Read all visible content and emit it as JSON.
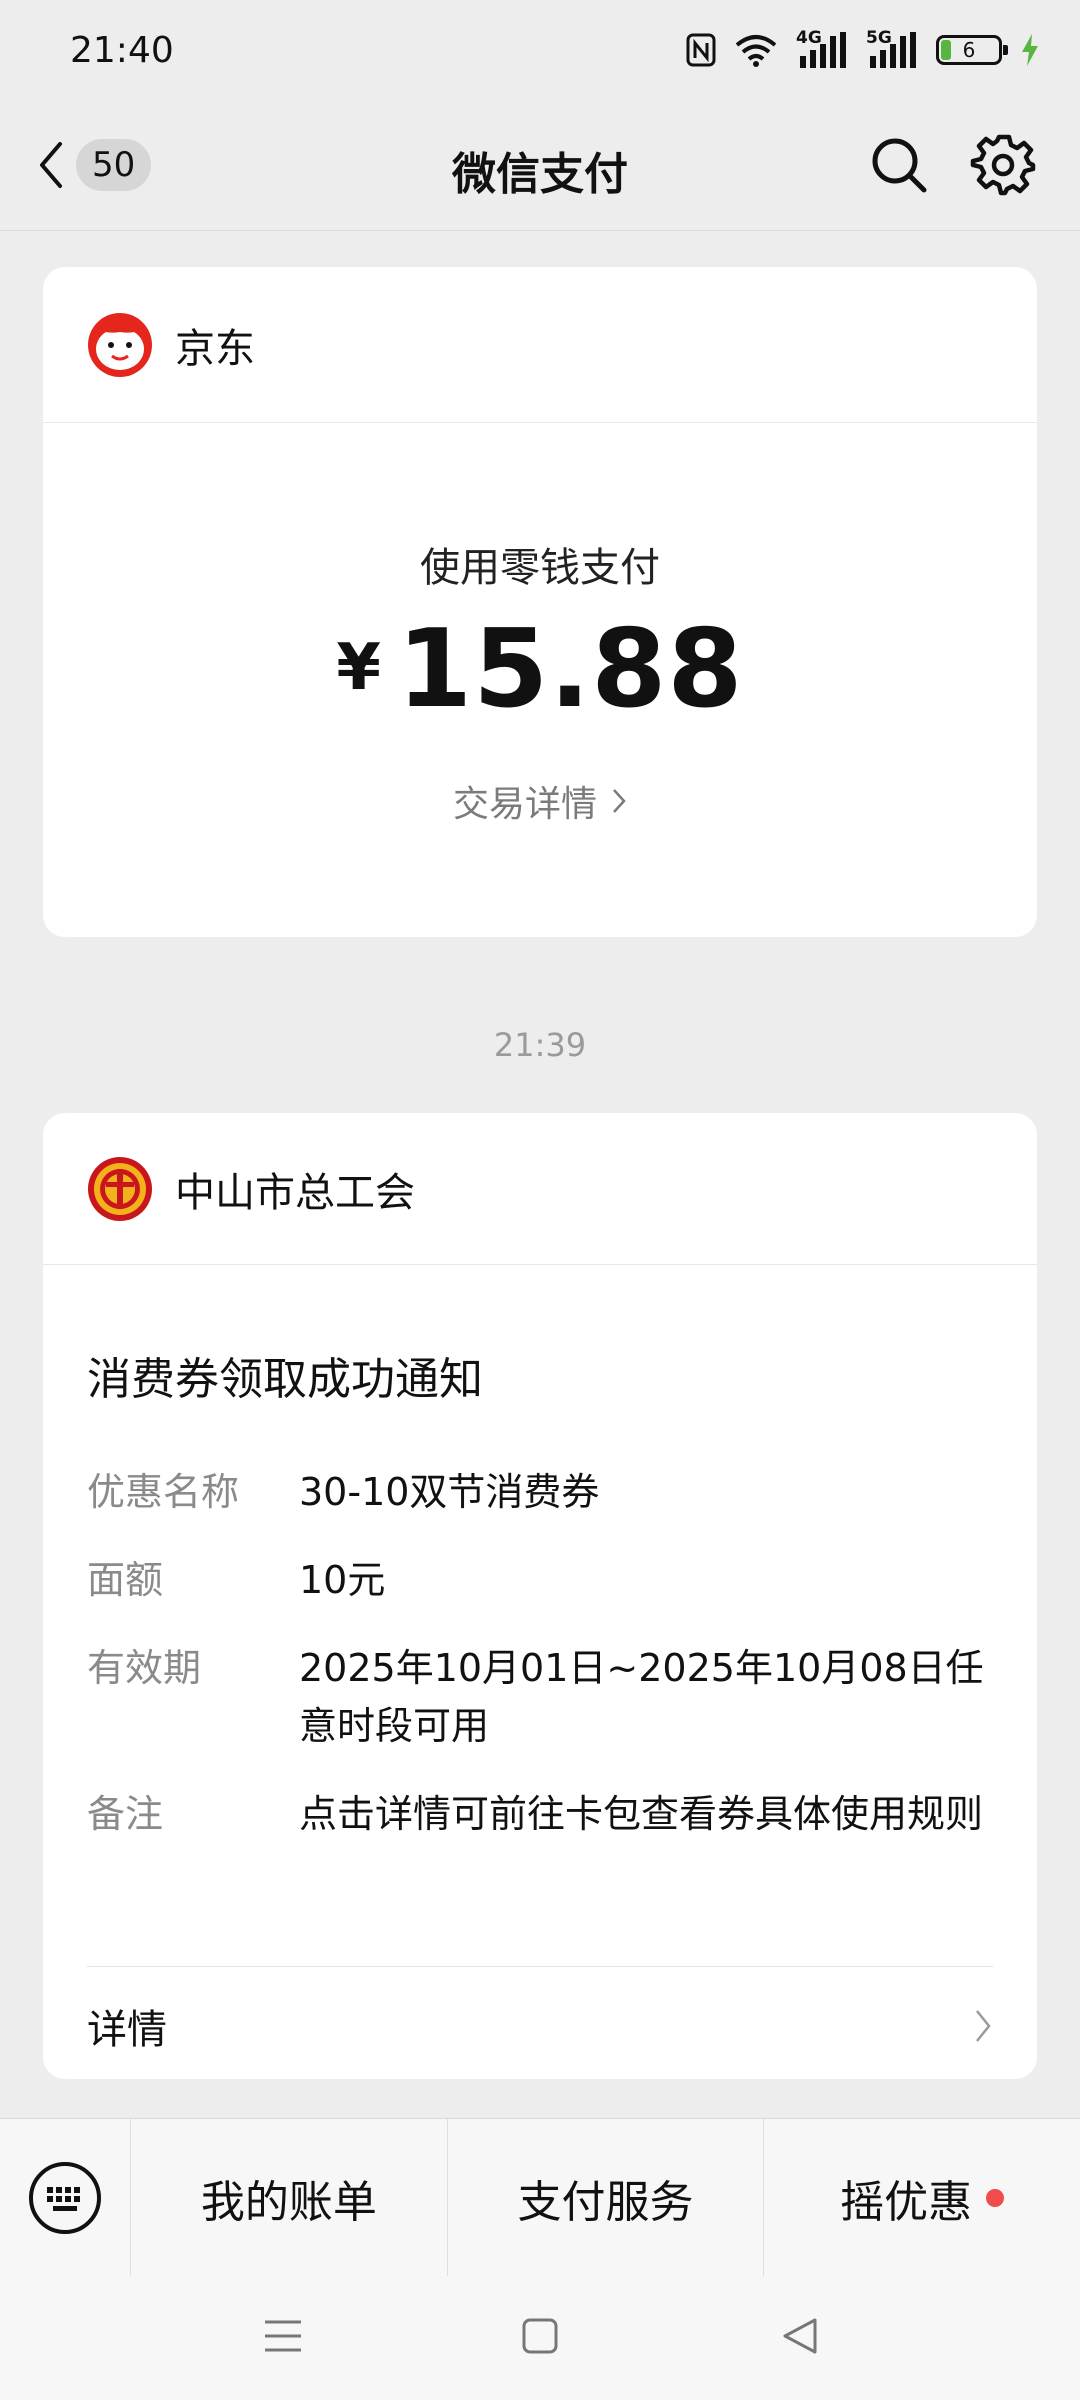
{
  "status_bar": {
    "time": "21:40",
    "network1": "4G",
    "network2": "5G",
    "battery": "6",
    "icons": [
      "nfc-icon",
      "wifi-icon",
      "signal-icon",
      "battery-icon",
      "charging-icon"
    ]
  },
  "nav": {
    "unread_count": "50",
    "title": "微信支付",
    "icons": [
      "back-arrow-icon",
      "search-icon",
      "gear-icon"
    ]
  },
  "payment_card": {
    "merchant": "京东",
    "pay_method": "使用零钱支付",
    "currency": "¥",
    "amount": "15.88",
    "detail_link": "交易详情"
  },
  "message_time": "21:39",
  "notice_card": {
    "merchant": "中山市总工会",
    "title": "消费券领取成功通知",
    "rows": [
      {
        "label": "优惠名称",
        "value": "30-10双节消费券"
      },
      {
        "label": "面额",
        "value": "10元"
      },
      {
        "label": "有效期",
        "value": "2025年10月01日~2025年10月08日任意时段可用"
      },
      {
        "label": "备注",
        "value": "点击详情可前往卡包查看券具体使用规则"
      }
    ],
    "detail_label": "详情"
  },
  "bottom_menu": {
    "items": [
      "我的账单",
      "支付服务",
      "摇优惠"
    ],
    "accent_dot_color": "#f24b4b"
  },
  "colors": {
    "background": "#ededed",
    "card": "#ffffff",
    "jd_red": "#e4261c",
    "union_gold": "#f3b21b",
    "union_red": "#c9161c"
  }
}
